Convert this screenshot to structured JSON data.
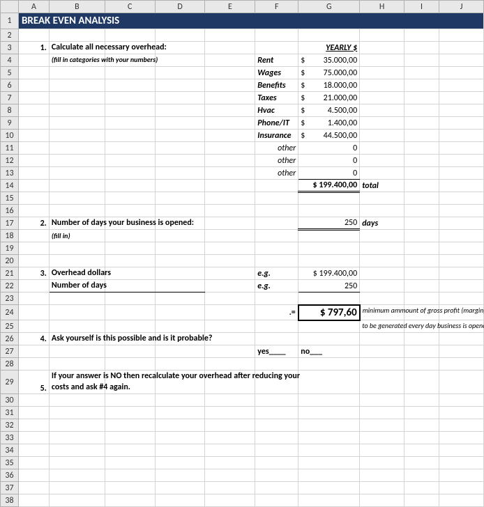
{
  "cols": [
    "",
    "A",
    "B",
    "C",
    "D",
    "E",
    "F",
    "G",
    "H",
    "I",
    "J"
  ],
  "title": "BREAK EVEN ANALYSIS",
  "sec1": {
    "num": "1.",
    "head": "Calculate all necessary overhead:",
    "hint": "(fill in categories with your numbers)",
    "yhead": "YEARLY  $"
  },
  "items": [
    {
      "label": "Rent",
      "cur": "$",
      "val": "35.000,00"
    },
    {
      "label": "Wages",
      "cur": "$",
      "val": "75.000,00"
    },
    {
      "label": "Benefits",
      "cur": "$",
      "val": "18.000,00"
    },
    {
      "label": "Taxes",
      "cur": "$",
      "val": "21.000,00"
    },
    {
      "label": "Hvac",
      "cur": "$",
      "val": "4.500,00"
    },
    {
      "label": "Phone/IT",
      "cur": "$",
      "val": "1.400,00"
    },
    {
      "label": "Insurance",
      "cur": "$",
      "val": "44.500,00"
    },
    {
      "label": "other",
      "cur": "",
      "val": "0"
    },
    {
      "label": "other",
      "cur": "",
      "val": "0"
    },
    {
      "label": "other",
      "cur": "",
      "val": "0"
    }
  ],
  "total": {
    "val": "$ 199.400,00",
    "label": "total"
  },
  "sec2": {
    "num": "2.",
    "head": "Number of days your business is opened:",
    "hint": "(fill in)",
    "val": "250",
    "unit": "days"
  },
  "sec3": {
    "num": "3.",
    "r1": "Overhead dollars",
    "eg": "e.g.",
    "v1": "$ 199.400,00",
    "r2": "Number of days",
    "v2": "250",
    "eq": ".=",
    "result": "$     797,60",
    "note1": "minimum ammount of gross profit (margin)",
    "note2": "to be generated every day business is opened"
  },
  "sec4": {
    "num": "4.",
    "head": "Ask yourself is this possible and is it probable?",
    "yes": "yes____",
    "no": "no___"
  },
  "sec5": {
    "num": "5.",
    "line1": "If your answer is NO then recalculate your overhead after reducing your",
    "line2": "costs and ask #4 again."
  }
}
